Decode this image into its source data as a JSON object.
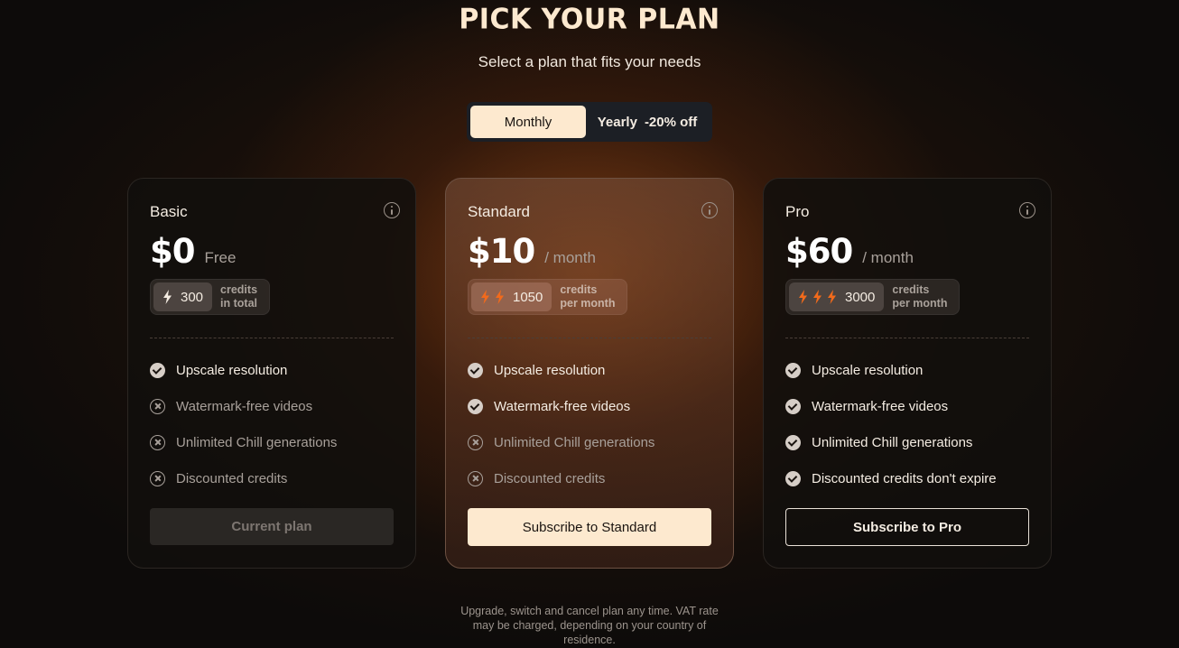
{
  "header": {
    "title": "PICK YOUR PLAN",
    "subtitle": "Select a plan that fits your needs"
  },
  "billing_toggle": {
    "monthly_label": "Monthly",
    "yearly_label": "Yearly",
    "yearly_discount": "-20% off",
    "selected": "Monthly"
  },
  "plans": [
    {
      "name": "Basic",
      "price": "$0",
      "period": "Free",
      "bolt_count": 1,
      "credits": "300",
      "credits_label_1": "credits",
      "credits_label_2": "in total",
      "features": [
        {
          "text": "Upscale resolution",
          "included": true
        },
        {
          "text": "Watermark-free videos",
          "included": false
        },
        {
          "text": "Unlimited Chill generations",
          "included": false
        },
        {
          "text": "Discounted credits",
          "included": false
        }
      ],
      "cta": "Current plan"
    },
    {
      "name": "Standard",
      "price": "$10",
      "period": "/ month",
      "bolt_count": 2,
      "credits": "1050",
      "credits_label_1": "credits",
      "credits_label_2": "per month",
      "features": [
        {
          "text": "Upscale resolution",
          "included": true
        },
        {
          "text": "Watermark-free videos",
          "included": true
        },
        {
          "text": "Unlimited Chill generations",
          "included": false
        },
        {
          "text": "Discounted credits",
          "included": false
        }
      ],
      "cta": "Subscribe to Standard"
    },
    {
      "name": "Pro",
      "price": "$60",
      "period": "/ month",
      "bolt_count": 3,
      "credits": "3000",
      "credits_label_1": "credits",
      "credits_label_2": "per month",
      "features": [
        {
          "text": "Upscale resolution",
          "included": true
        },
        {
          "text": "Watermark-free videos",
          "included": true
        },
        {
          "text": "Unlimited Chill generations",
          "included": true
        },
        {
          "text": "Discounted credits don't expire",
          "included": true
        }
      ],
      "cta": "Subscribe to Pro"
    }
  ],
  "footnote": "Upgrade, switch and cancel plan any time. VAT rate may be charged, depending on your country of residence.",
  "colors": {
    "accent": "#fde9cf",
    "bolt_orange": "#f26a1b",
    "bolt_white": "#f4ece2",
    "background": "#0d0b0a"
  }
}
